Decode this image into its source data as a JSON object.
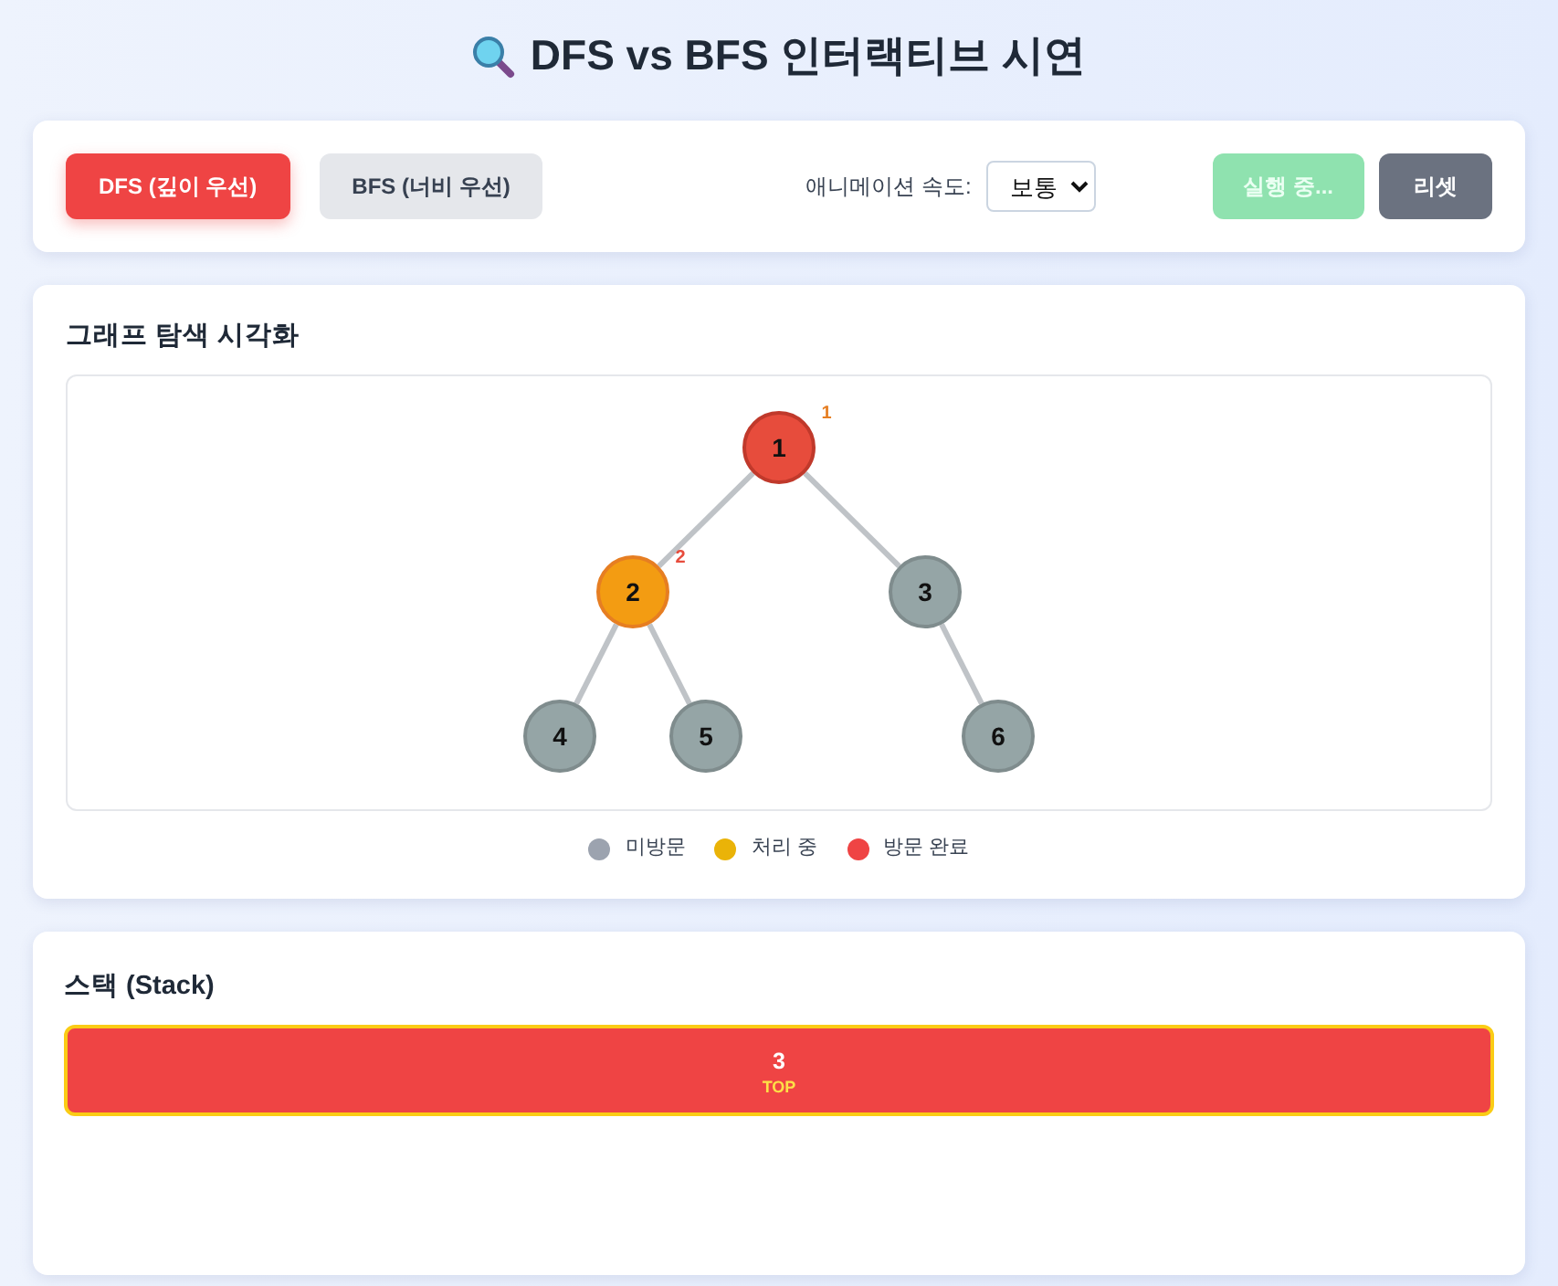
{
  "page": {
    "title": "DFS vs BFS 인터랙티브 시연"
  },
  "controls": {
    "algorithms": [
      {
        "label": "DFS (깊이 우선)",
        "selected": true
      },
      {
        "label": "BFS (너비 우선)",
        "selected": false
      }
    ],
    "speed": {
      "label": "애니메이션 속도:",
      "value": "보통"
    },
    "run_button": {
      "label": "실행 중...",
      "disabled": true
    },
    "reset_button": {
      "label": "리셋"
    }
  },
  "graph": {
    "title": "그래프 탐색 시각화",
    "tree": {
      "label": "1",
      "visited": true,
      "processing": false,
      "order": "1",
      "children": [
        {
          "kind": "left",
          "label": "2",
          "visited": false,
          "processing": true,
          "order": "2",
          "children": [
            {
              "kind": "left",
              "label": "4",
              "visited": false,
              "processing": false
            },
            {
              "kind": "right",
              "label": "5",
              "visited": false,
              "processing": false
            }
          ]
        },
        {
          "kind": "right",
          "label": "3",
          "visited": false,
          "processing": false,
          "children": [
            {
              "kind": "right",
              "label": "6",
              "visited": false,
              "processing": false
            }
          ]
        }
      ]
    },
    "legend": [
      {
        "label": "미방문",
        "color": "#9ca3af"
      },
      {
        "label": "처리 중",
        "color": "#eab308"
      },
      {
        "label": "방문 완료",
        "color": "#ef4444"
      }
    ]
  },
  "stack": {
    "title": "스택 (Stack)",
    "items": [
      {
        "value": "3",
        "top": true,
        "tag": "TOP"
      }
    ]
  }
}
